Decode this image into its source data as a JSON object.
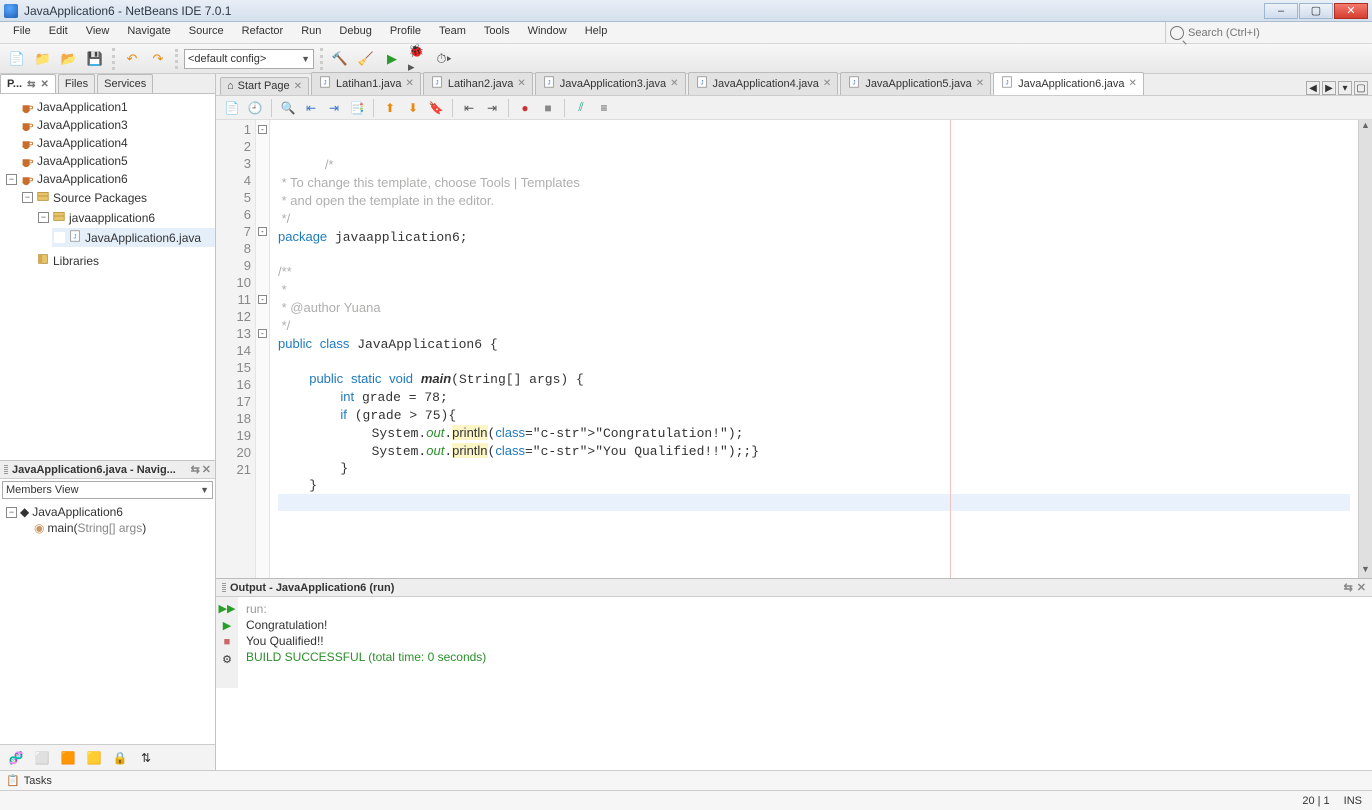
{
  "window": {
    "title": "JavaApplication6 - NetBeans IDE 7.0.1"
  },
  "menu": [
    "File",
    "Edit",
    "View",
    "Navigate",
    "Source",
    "Refactor",
    "Run",
    "Debug",
    "Profile",
    "Team",
    "Tools",
    "Window",
    "Help"
  ],
  "search_placeholder": "Search (Ctrl+I)",
  "toolbar": {
    "config_selected": "<default config>"
  },
  "left_tabs": {
    "projects": "P...",
    "files": "Files",
    "services": "Services"
  },
  "projects": [
    {
      "name": "JavaApplication1"
    },
    {
      "name": "JavaApplication3"
    },
    {
      "name": "JavaApplication4"
    },
    {
      "name": "JavaApplication5"
    },
    {
      "name": "JavaApplication6",
      "expanded": true,
      "children": [
        {
          "name": "Source Packages",
          "expanded": true,
          "kind": "pkgroot",
          "children": [
            {
              "name": "javaapplication6",
              "expanded": true,
              "kind": "pkg",
              "children": [
                {
                  "name": "JavaApplication6.java",
                  "kind": "jfile",
                  "selected": true
                }
              ]
            }
          ]
        },
        {
          "name": "Libraries",
          "kind": "lib"
        }
      ]
    }
  ],
  "navigator": {
    "title": "JavaApplication6.java - Navig...",
    "view_label": "Members View",
    "root": "JavaApplication6",
    "members": [
      "main(String[] args)"
    ]
  },
  "editor_tabs": [
    {
      "label": "Start Page"
    },
    {
      "label": "Latihan1.java"
    },
    {
      "label": "Latihan2.java"
    },
    {
      "label": "JavaApplication3.java"
    },
    {
      "label": "JavaApplication4.java"
    },
    {
      "label": "JavaApplication5.java"
    },
    {
      "label": "JavaApplication6.java",
      "active": true
    }
  ],
  "code": {
    "linecount": 21,
    "lines": [
      "/*",
      " * To change this template, choose Tools | Templates",
      " * and open the template in the editor.",
      " */",
      "package javaapplication6;",
      "",
      "/**",
      " *",
      " * @author Yuana",
      " */",
      "public class JavaApplication6 {",
      "",
      "    public static void main(String[] args) {",
      "        int grade = 78;",
      "        if (grade > 75){",
      "            System.out.println(\"Congratulation!\");",
      "            System.out.println(\"You Qualified!!\");;}",
      "        }",
      "    }",
      "",
      ""
    ]
  },
  "output": {
    "title": "Output - JavaApplication6 (run)",
    "lines": [
      {
        "text": "run:",
        "cls": "out-run"
      },
      {
        "text": "Congratulation!",
        "cls": ""
      },
      {
        "text": "You Qualified!!",
        "cls": ""
      },
      {
        "text": "BUILD SUCCESSFUL (total time: 0 seconds)",
        "cls": "out-ok"
      }
    ]
  },
  "tasks_label": "Tasks",
  "status": {
    "cursor": "20 | 1",
    "mode": "INS"
  }
}
